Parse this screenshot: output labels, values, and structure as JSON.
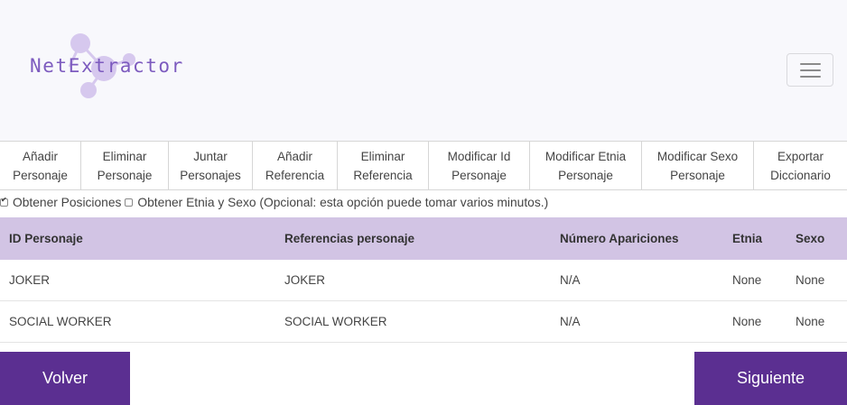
{
  "brand": {
    "name": "NetExtractor"
  },
  "toolbar": {
    "buttons": [
      {
        "label": "Añadir\nPersonaje"
      },
      {
        "label": "Eliminar\nPersonaje"
      },
      {
        "label": "Juntar\nPersonajes"
      },
      {
        "label": "Añadir\nReferencia"
      },
      {
        "label": "Eliminar\nReferencia"
      },
      {
        "label": "Modificar Id\nPersonaje"
      },
      {
        "label": "Modificar Etnia\nPersonaje"
      },
      {
        "label": "Modificar Sexo\nPersonaje"
      },
      {
        "label": "Exportar\nDiccionario"
      }
    ]
  },
  "options": {
    "positions_label": "Obtener Posiciones",
    "positions_checked": true,
    "ethnicity_label": "Obtener Etnia y Sexo (Opcional: esta opción puede tomar varios minutos.)",
    "ethnicity_checked": false
  },
  "table": {
    "headers": [
      "ID Personaje",
      "Referencias personaje",
      "Número Apariciones",
      "Etnia",
      "Sexo"
    ],
    "rows": [
      [
        "JOKER",
        "JOKER",
        "N/A",
        "None",
        "None"
      ],
      [
        "SOCIAL WORKER",
        "SOCIAL WORKER",
        "N/A",
        "None",
        "None"
      ]
    ]
  },
  "buttons": {
    "back": "Volver",
    "next": "Siguiente"
  },
  "colors": {
    "accent": "#5b2f91",
    "header_row": "#d2c4e4",
    "logo": "#7d5bbf"
  }
}
